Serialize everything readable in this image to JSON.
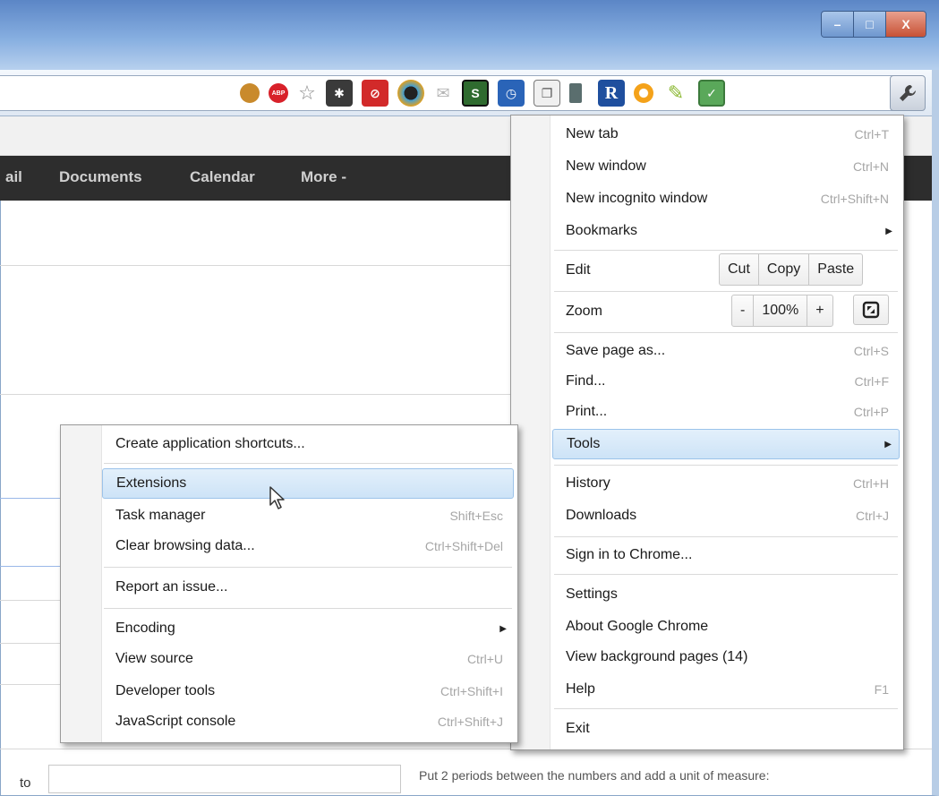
{
  "window": {
    "controls": {
      "minimize": "–",
      "maximize": "□",
      "close": "X"
    }
  },
  "toolbar": {
    "extensions": [
      {
        "icon": "cookie-icon",
        "color": "#c98a2c"
      },
      {
        "icon": "adblock-icon",
        "color": "#d8212a",
        "label": "ABP"
      },
      {
        "icon": "star-icon",
        "color": "#888888"
      },
      {
        "icon": "asterisk-extension-icon",
        "color": "#3a3a3a"
      },
      {
        "icon": "stop-extension-icon",
        "color": "#d22a2a"
      },
      {
        "icon": "color-wheel-icon",
        "color": "#222222"
      },
      {
        "icon": "mail-icon",
        "color": "#b5b5b5"
      },
      {
        "icon": "s-extension-icon",
        "color": "#2f6b2f",
        "label": "S"
      },
      {
        "icon": "clock-icon",
        "color": "#2a64b8"
      },
      {
        "icon": "document-icon",
        "color": "#777777"
      },
      {
        "icon": "book-icon",
        "color": "#5a6e6e"
      },
      {
        "icon": "r-extension-icon",
        "color": "#1f4f9e",
        "label": "R"
      },
      {
        "icon": "orange-circle-icon",
        "color": "#f4a21a"
      },
      {
        "icon": "bird-icon",
        "color": "#8bb832"
      },
      {
        "icon": "green-square-icon",
        "color": "#5aa85a"
      },
      {
        "icon": "wrench-icon",
        "color": "#555555"
      }
    ]
  },
  "google_bar": {
    "items": [
      "ail",
      "Documents",
      "Calendar",
      "More -"
    ]
  },
  "page": {
    "bottom_label": "to",
    "hint": "Put 2 periods between the numbers and add a unit of measure:"
  },
  "main_menu": {
    "new_tab": {
      "label": "New tab",
      "shortcut": "Ctrl+T"
    },
    "new_window": {
      "label": "New window",
      "shortcut": "Ctrl+N"
    },
    "new_incognito": {
      "label": "New incognito window",
      "shortcut": "Ctrl+Shift+N"
    },
    "bookmarks": {
      "label": "Bookmarks"
    },
    "edit": {
      "label": "Edit",
      "cut": "Cut",
      "copy": "Copy",
      "paste": "Paste"
    },
    "zoom": {
      "label": "Zoom",
      "minus": "-",
      "level": "100%",
      "plus": "+"
    },
    "save_page": {
      "label": "Save page as...",
      "shortcut": "Ctrl+S"
    },
    "find": {
      "label": "Find...",
      "shortcut": "Ctrl+F"
    },
    "print": {
      "label": "Print...",
      "shortcut": "Ctrl+P"
    },
    "tools": {
      "label": "Tools"
    },
    "history": {
      "label": "History",
      "shortcut": "Ctrl+H"
    },
    "downloads": {
      "label": "Downloads",
      "shortcut": "Ctrl+J"
    },
    "sign_in": {
      "label": "Sign in to Chrome..."
    },
    "settings": {
      "label": "Settings"
    },
    "about": {
      "label": "About Google Chrome"
    },
    "background_pages": {
      "label": "View background pages (14)"
    },
    "help": {
      "label": "Help",
      "shortcut": "F1"
    },
    "exit": {
      "label": "Exit"
    }
  },
  "tools_menu": {
    "create_shortcuts": {
      "label": "Create application shortcuts..."
    },
    "extensions": {
      "label": "Extensions"
    },
    "task_manager": {
      "label": "Task manager",
      "shortcut": "Shift+Esc"
    },
    "clear_data": {
      "label": "Clear browsing data...",
      "shortcut": "Ctrl+Shift+Del"
    },
    "report_issue": {
      "label": "Report an issue..."
    },
    "encoding": {
      "label": "Encoding"
    },
    "view_source": {
      "label": "View source",
      "shortcut": "Ctrl+U"
    },
    "dev_tools": {
      "label": "Developer tools",
      "shortcut": "Ctrl+Shift+I"
    },
    "js_console": {
      "label": "JavaScript console",
      "shortcut": "Ctrl+Shift+J"
    }
  }
}
